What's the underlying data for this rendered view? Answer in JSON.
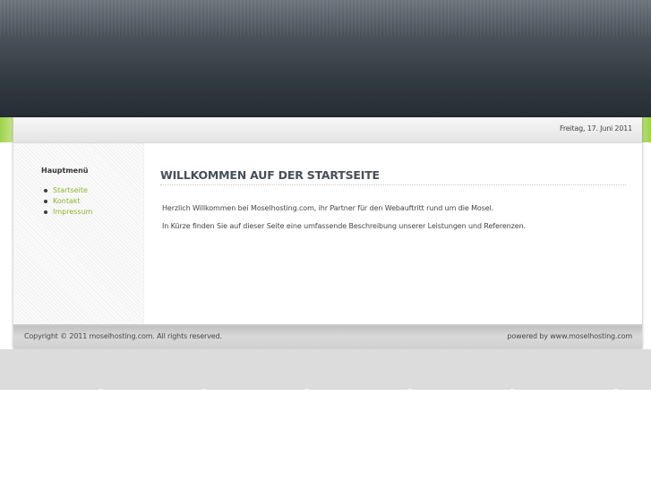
{
  "header": {
    "date": "Freitag, 17. Juni 2011"
  },
  "sidebar": {
    "title": "Hauptmenü",
    "items": [
      {
        "label": "Startseite"
      },
      {
        "label": "Kontakt"
      },
      {
        "label": "Impressum"
      }
    ]
  },
  "main": {
    "heading": "WILLKOMMEN AUF DER STARTSEITE",
    "paragraphs": [
      "Herzlich Willkommen bei Moselhosting.com, ihr Partner für den Webauftritt rund um die Mosel.",
      "In Kürze finden Sie auf dieser Seite eine umfassende Beschreibung unserer Leistungen und Referenzen."
    ]
  },
  "footer": {
    "copyright": "Copyright © 2011 moselhosting.com. All rights reserved.",
    "powered": "powered by www.moselhosting.com"
  },
  "colors": {
    "accent_green": "#8bb531",
    "header_dark": "#262d34"
  }
}
